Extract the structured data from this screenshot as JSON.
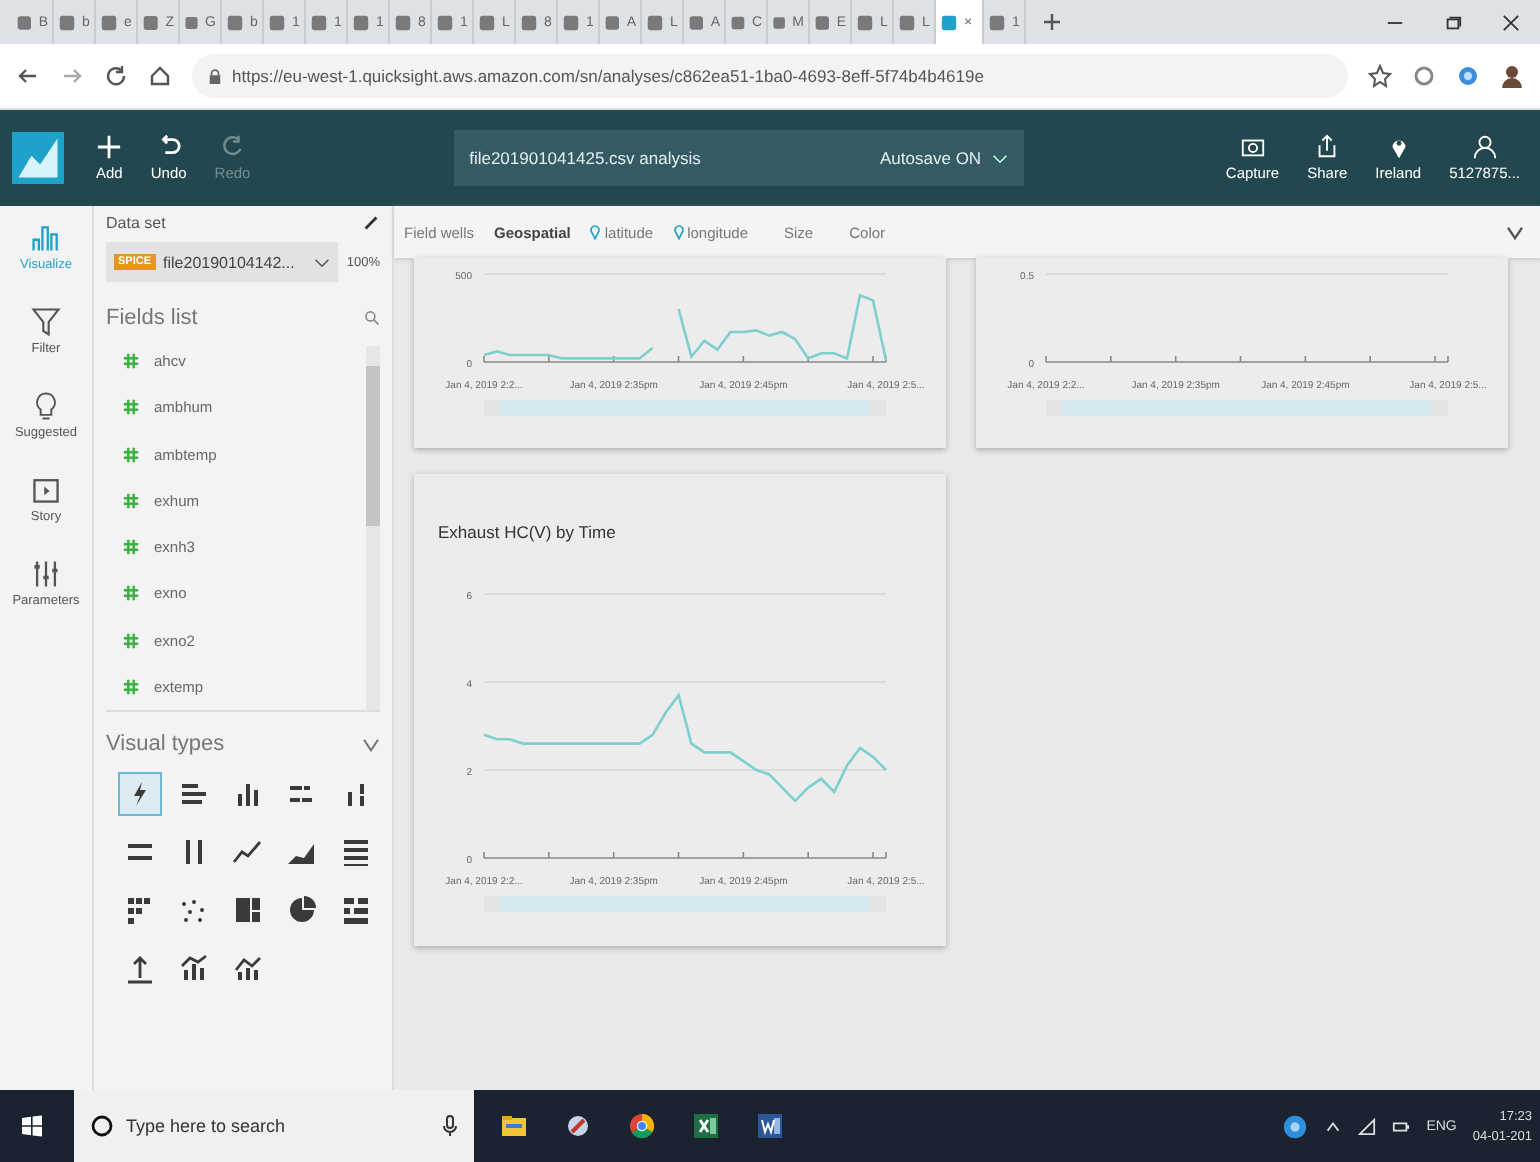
{
  "browser": {
    "tabs": [
      {
        "label": "B",
        "selected": false
      },
      {
        "label": "b",
        "selected": false
      },
      {
        "label": "e",
        "selected": false
      },
      {
        "label": "Z",
        "selected": false
      },
      {
        "label": "G",
        "selected": false
      },
      {
        "label": "b",
        "selected": false
      },
      {
        "label": "1",
        "selected": false
      },
      {
        "label": "1",
        "selected": false
      },
      {
        "label": "1",
        "selected": false
      },
      {
        "label": "8",
        "selected": false
      },
      {
        "label": "1",
        "selected": false
      },
      {
        "label": "L",
        "selected": false
      },
      {
        "label": "8",
        "selected": false
      },
      {
        "label": "1",
        "selected": false
      },
      {
        "label": "A",
        "selected": false
      },
      {
        "label": "L",
        "selected": false
      },
      {
        "label": "A",
        "selected": false
      },
      {
        "label": "C",
        "selected": false
      },
      {
        "label": "M",
        "selected": false
      },
      {
        "label": "E",
        "selected": false
      },
      {
        "label": "L",
        "selected": false
      },
      {
        "label": "L",
        "selected": false
      },
      {
        "close": "×",
        "selected": true
      },
      {
        "label": "1",
        "selected": false
      }
    ],
    "url": "https://eu-west-1.quicksight.aws.amazon.com/sn/analyses/c862ea51-1ba0-4693-8eff-5f74b4b4619e"
  },
  "toolbar": {
    "actions": [
      {
        "label": "Add",
        "kind": "add",
        "disabled": false
      },
      {
        "label": "Undo",
        "kind": "undo",
        "disabled": false
      },
      {
        "label": "Redo",
        "kind": "redo",
        "disabled": true
      }
    ],
    "analysis_name": "file201901041425.csv analysis",
    "autosave": "Autosave ON",
    "right_actions": [
      {
        "label": "Capture",
        "kind": "capture"
      },
      {
        "label": "Share",
        "kind": "share"
      },
      {
        "label": "Ireland",
        "kind": "region"
      },
      {
        "label": "5127875...",
        "kind": "user"
      }
    ]
  },
  "rail": [
    {
      "label": "Visualize",
      "kind": "visualize",
      "selected": true
    },
    {
      "label": "Filter",
      "kind": "filter",
      "selected": false
    },
    {
      "label": "Suggested",
      "kind": "suggested",
      "selected": false
    },
    {
      "label": "Story",
      "kind": "story",
      "selected": false
    },
    {
      "label": "Parameters",
      "kind": "parameters",
      "selected": false
    }
  ],
  "panel": {
    "dataset_label": "Data set",
    "badge": "SPICE",
    "dataset": "file20190104142...",
    "percent": "100%",
    "fields_title": "Fields list",
    "fields": [
      "ahcv",
      "ambhum",
      "ambtemp",
      "exhum",
      "exnh3",
      "exno",
      "exno2",
      "extemp"
    ],
    "visual_types_title": "Visual types",
    "visual_types": [
      {
        "kind": "autograph",
        "selected": true
      },
      {
        "kind": "hbar",
        "selected": false
      },
      {
        "kind": "vbar",
        "selected": false
      },
      {
        "kind": "hstack",
        "selected": false
      },
      {
        "kind": "vstack",
        "selected": false
      },
      {
        "kind": "hstack100",
        "selected": false
      },
      {
        "kind": "vstack100",
        "selected": false
      },
      {
        "kind": "line",
        "selected": false
      },
      {
        "kind": "area",
        "selected": false
      },
      {
        "kind": "pivot",
        "selected": false
      },
      {
        "kind": "heatmap",
        "selected": false
      },
      {
        "kind": "scatter",
        "selected": false
      },
      {
        "kind": "treemap",
        "selected": false
      },
      {
        "kind": "pie",
        "selected": false
      },
      {
        "kind": "grid",
        "selected": false
      },
      {
        "kind": "kpi",
        "selected": false
      },
      {
        "kind": "combo",
        "selected": false
      },
      {
        "kind": "combo2",
        "selected": false
      }
    ]
  },
  "field_wells": {
    "label": "Field wells",
    "group": "Geospatial",
    "wells": [
      {
        "label": "latitude",
        "kind": "geo"
      },
      {
        "label": "longitude",
        "kind": "geo"
      },
      {
        "label": "Size",
        "kind": "plain"
      },
      {
        "label": "Color",
        "kind": "plain"
      }
    ]
  },
  "visuals": [
    {
      "chart_data": {
        "type": "line",
        "categories": [
          "Jan 4, 2019 2:2...",
          null,
          null,
          null,
          null,
          null,
          null,
          null,
          null,
          null,
          "Jan 4, 2019 2:35pm",
          null,
          null,
          null,
          null,
          null,
          null,
          null,
          null,
          null,
          "Jan 4, 2019 2:45pm",
          null,
          null,
          null,
          null,
          null,
          null,
          null,
          null,
          null,
          null,
          "Jan 4, 2019 2:5..."
        ],
        "series": [
          {
            "color": "#7ecfcf",
            "values": [
              40,
              60,
              40,
              40,
              40,
              40,
              20,
              20,
              20,
              20,
              20,
              20,
              20,
              80,
              null,
              300,
              30,
              120,
              70,
              170,
              170,
              180,
              150,
              170,
              130,
              20,
              50,
              50,
              20,
              380,
              350,
              10
            ]
          }
        ],
        "ylim": [
          0,
          500
        ],
        "yticks": [
          0,
          500
        ]
      }
    },
    {
      "chart_data": {
        "type": "line",
        "categories": [
          "Jan 4, 2019 2:2...",
          null,
          null,
          null,
          null,
          null,
          null,
          null,
          null,
          null,
          "Jan 4, 2019 2:35pm",
          null,
          null,
          null,
          null,
          null,
          null,
          null,
          null,
          null,
          "Jan 4, 2019 2:45pm",
          null,
          null,
          null,
          null,
          null,
          null,
          null,
          null,
          null,
          null,
          "Jan 4, 2019 2:5..."
        ],
        "ylim": [
          0,
          0.5
        ],
        "yticks": [
          0,
          0.5
        ]
      }
    },
    {
      "title": "Exhaust HC(V) by Time",
      "chart_data": {
        "type": "line",
        "categories": [
          "Jan 4, 2019 2:2...",
          null,
          null,
          null,
          null,
          null,
          null,
          null,
          null,
          null,
          "Jan 4, 2019 2:35pm",
          null,
          null,
          null,
          null,
          null,
          null,
          null,
          null,
          null,
          "Jan 4, 2019 2:45pm",
          null,
          null,
          null,
          null,
          null,
          null,
          null,
          null,
          null,
          null,
          "Jan 4, 2019 2:5..."
        ],
        "series": [
          {
            "color": "#7ecfcf",
            "values": [
              2.8,
              2.7,
              2.7,
              2.6,
              2.6,
              2.6,
              2.6,
              2.6,
              2.6,
              2.6,
              2.6,
              2.6,
              2.6,
              2.8,
              3.3,
              3.7,
              2.6,
              2.4,
              2.4,
              2.4,
              2.2,
              2.0,
              1.9,
              1.6,
              1.3,
              1.6,
              1.8,
              1.5,
              2.1,
              2.5,
              2.3,
              2.0
            ]
          }
        ],
        "ylim": [
          0,
          6
        ],
        "yticks": [
          0,
          2,
          4,
          6
        ]
      }
    }
  ],
  "taskbar": {
    "search_placeholder": "Type here to search",
    "language": "ENG",
    "time": "17:23",
    "date": "04-01-201"
  }
}
